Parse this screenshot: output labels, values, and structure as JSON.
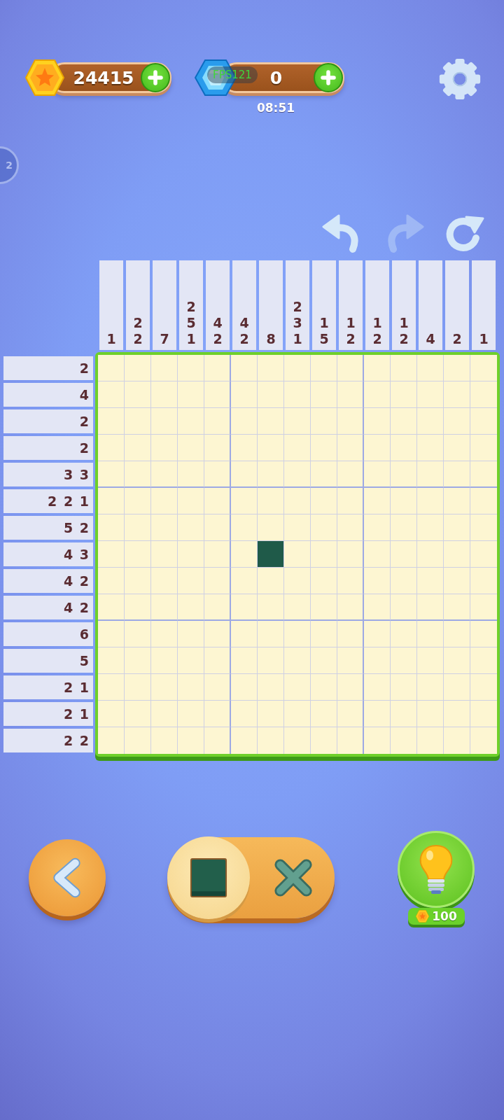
{
  "top_bar": {
    "coins": "24415",
    "gems": "0",
    "fps_overlay": "FPS121",
    "timer": "08:51"
  },
  "side_badge": "2",
  "toolbar": [
    {
      "kind": "undo",
      "disabled": false
    },
    {
      "kind": "redo",
      "disabled": true
    },
    {
      "kind": "restart",
      "disabled": false
    }
  ],
  "puzzle": {
    "column_clues": [
      [
        "1"
      ],
      [
        "2",
        "2"
      ],
      [
        "7"
      ],
      [
        "2",
        "5",
        "1"
      ],
      [
        "4",
        "2"
      ],
      [
        "4",
        "2"
      ],
      [
        "8"
      ],
      [
        "2",
        "3",
        "1"
      ],
      [
        "1",
        "5"
      ],
      [
        "1",
        "2"
      ],
      [
        "1",
        "2"
      ],
      [
        "1",
        "2"
      ],
      [
        "4"
      ],
      [
        "2"
      ],
      [
        "1"
      ]
    ],
    "rows": [
      {
        "clue": "2",
        "filled": [
          false,
          false,
          false,
          false,
          false,
          false,
          false,
          false,
          false,
          false,
          false,
          false,
          false,
          false,
          false
        ]
      },
      {
        "clue": "4",
        "filled": [
          false,
          false,
          false,
          false,
          false,
          false,
          false,
          false,
          false,
          false,
          false,
          false,
          false,
          false,
          false
        ]
      },
      {
        "clue": "2",
        "filled": [
          false,
          false,
          false,
          false,
          false,
          false,
          false,
          false,
          false,
          false,
          false,
          false,
          false,
          false,
          false
        ]
      },
      {
        "clue": "2",
        "filled": [
          false,
          false,
          false,
          false,
          false,
          false,
          false,
          false,
          false,
          false,
          false,
          false,
          false,
          false,
          false
        ]
      },
      {
        "clue": "3 3",
        "filled": [
          false,
          false,
          false,
          false,
          false,
          false,
          false,
          false,
          false,
          false,
          false,
          false,
          false,
          false,
          false
        ]
      },
      {
        "clue": "2 2 1",
        "filled": [
          false,
          false,
          false,
          false,
          false,
          false,
          false,
          false,
          false,
          false,
          false,
          false,
          false,
          false,
          false
        ]
      },
      {
        "clue": "5 2",
        "filled": [
          false,
          false,
          false,
          false,
          false,
          false,
          false,
          false,
          false,
          false,
          false,
          false,
          false,
          false,
          false
        ]
      },
      {
        "clue": "4 3",
        "filled": [
          false,
          false,
          false,
          false,
          false,
          false,
          true,
          false,
          false,
          false,
          false,
          false,
          false,
          false,
          false
        ]
      },
      {
        "clue": "4 2",
        "filled": [
          false,
          false,
          false,
          false,
          false,
          false,
          false,
          false,
          false,
          false,
          false,
          false,
          false,
          false,
          false
        ]
      },
      {
        "clue": "4 2",
        "filled": [
          false,
          false,
          false,
          false,
          false,
          false,
          false,
          false,
          false,
          false,
          false,
          false,
          false,
          false,
          false
        ]
      },
      {
        "clue": "6",
        "filled": [
          false,
          false,
          false,
          false,
          false,
          false,
          false,
          false,
          false,
          false,
          false,
          false,
          false,
          false,
          false
        ]
      },
      {
        "clue": "5",
        "filled": [
          false,
          false,
          false,
          false,
          false,
          false,
          false,
          false,
          false,
          false,
          false,
          false,
          false,
          false,
          false
        ]
      },
      {
        "clue": "2 1",
        "filled": [
          false,
          false,
          false,
          false,
          false,
          false,
          false,
          false,
          false,
          false,
          false,
          false,
          false,
          false,
          false
        ]
      },
      {
        "clue": "2 1",
        "filled": [
          false,
          false,
          false,
          false,
          false,
          false,
          false,
          false,
          false,
          false,
          false,
          false,
          false,
          false,
          false
        ]
      },
      {
        "clue": "2 2",
        "filled": [
          false,
          false,
          false,
          false,
          false,
          false,
          false,
          false,
          false,
          false,
          false,
          false,
          false,
          false,
          false
        ]
      }
    ]
  },
  "bottom_bar": {
    "modes": [
      {
        "kind": "fill",
        "selected": true
      },
      {
        "kind": "cross",
        "selected": false
      }
    ],
    "hint_cost": "100"
  }
}
